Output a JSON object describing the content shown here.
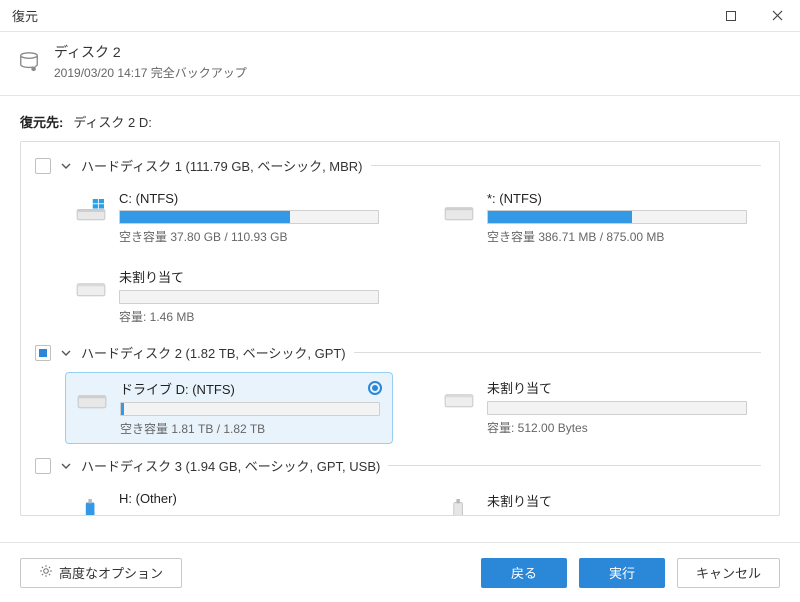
{
  "window": {
    "title": "復元"
  },
  "header": {
    "title": "ディスク 2",
    "subtitle": "2019/03/20 14:17 完全バックアップ"
  },
  "destination": {
    "label": "復元先:",
    "value": "ディスク 2 D:"
  },
  "disks": [
    {
      "title": "ハードディスク 1 (111.79 GB, ベーシック, MBR)",
      "checked": "none",
      "partitions": [
        {
          "name": "C: (NTFS)",
          "info": "空き容量 37.80 GB / 110.93 GB",
          "fill_pct": 66,
          "icon": "windows-drive",
          "selected": false
        },
        {
          "name": "*: (NTFS)",
          "info": "空き容量 386.71 MB / 875.00 MB",
          "fill_pct": 56,
          "icon": "drive",
          "selected": false
        },
        {
          "name": "未割り当て",
          "info": "容量: 1.46 MB",
          "fill_pct": 0,
          "icon": "drive",
          "selected": false
        }
      ]
    },
    {
      "title": "ハードディスク 2 (1.82 TB, ベーシック, GPT)",
      "checked": "partial",
      "partitions": [
        {
          "name": "ドライブ D: (NTFS)",
          "info": "空き容量 1.81 TB / 1.82 TB",
          "fill_pct": 1,
          "icon": "drive",
          "selected": true
        },
        {
          "name": "未割り当て",
          "info": "容量: 512.00 Bytes",
          "fill_pct": 0,
          "icon": "drive",
          "selected": false
        }
      ]
    },
    {
      "title": "ハードディスク 3 (1.94 GB, ベーシック, GPT, USB)",
      "checked": "none",
      "partitions": [
        {
          "name": "H: (Other)",
          "info": "",
          "fill_pct": 0,
          "icon": "usb",
          "selected": false
        },
        {
          "name": "未割り当て",
          "info": "",
          "fill_pct": 0,
          "icon": "usb",
          "selected": false
        }
      ]
    }
  ],
  "footer": {
    "advanced": "高度なオプション",
    "back": "戻る",
    "execute": "実行",
    "cancel": "キャンセル"
  }
}
